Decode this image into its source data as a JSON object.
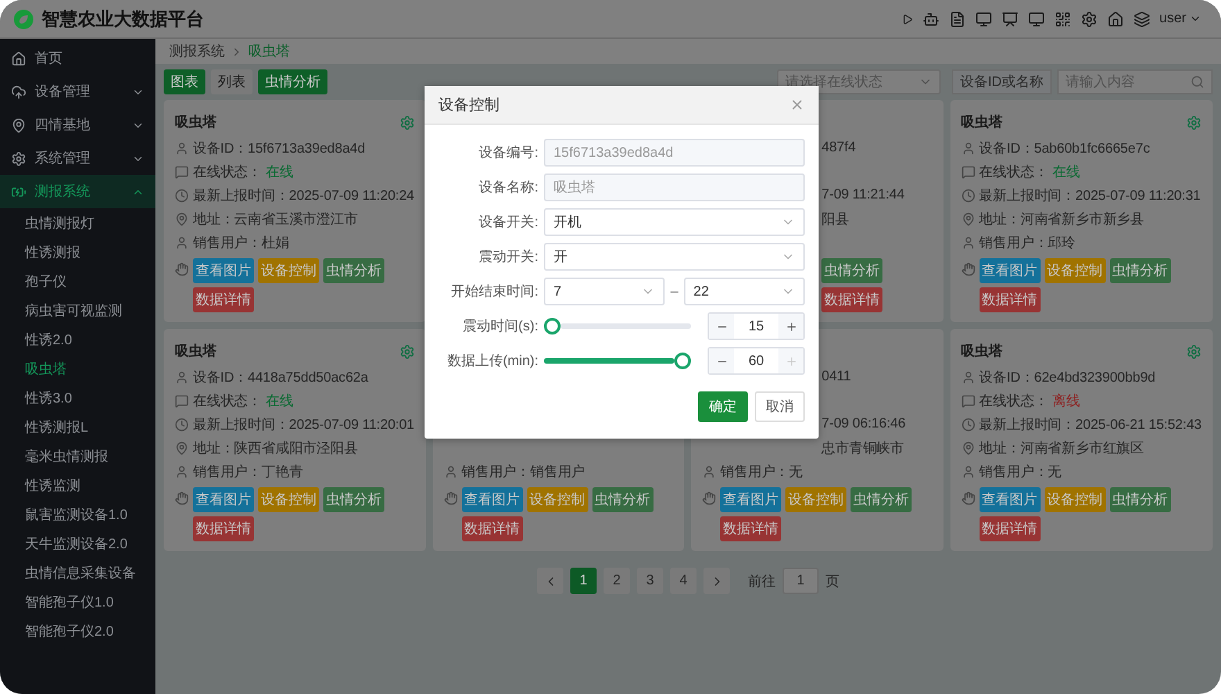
{
  "header": {
    "title": "智慧农业大数据平台",
    "user": "user"
  },
  "sidebar": {
    "items": [
      {
        "label": "首页",
        "selected": false
      },
      {
        "label": "设备管理",
        "selected": false,
        "expanded": false
      },
      {
        "label": "四情基地",
        "selected": false,
        "expanded": false
      },
      {
        "label": "系统管理",
        "selected": false,
        "expanded": false
      },
      {
        "label": "测报系统",
        "selected": true,
        "expanded": true,
        "children": [
          {
            "label": "虫情测报灯",
            "selected": false
          },
          {
            "label": "性诱测报",
            "selected": false
          },
          {
            "label": "孢子仪",
            "selected": false
          },
          {
            "label": "病虫害可视监测",
            "selected": false
          },
          {
            "label": "性诱2.0",
            "selected": false
          },
          {
            "label": "吸虫塔",
            "selected": true
          },
          {
            "label": "性诱3.0",
            "selected": false
          },
          {
            "label": "性诱测报L",
            "selected": false
          },
          {
            "label": "毫米虫情测报",
            "selected": false
          },
          {
            "label": "性诱监测",
            "selected": false
          },
          {
            "label": "鼠害监测设备1.0",
            "selected": false
          },
          {
            "label": "天牛监测设备2.0",
            "selected": false
          },
          {
            "label": "虫情信息采集设备",
            "selected": false
          },
          {
            "label": "智能孢子仪1.0",
            "selected": false
          },
          {
            "label": "智能孢子仪2.0",
            "selected": false
          }
        ]
      }
    ]
  },
  "breadcrumb": [
    {
      "label": "测报系统",
      "selected": false
    },
    {
      "label": "吸虫塔",
      "selected": true
    }
  ],
  "toolbar": {
    "buttons": [
      {
        "label": "图表",
        "color": "#0e5f28"
      },
      {
        "label": "列表",
        "color": "#7a7a7a"
      },
      {
        "label": "虫情分析",
        "color": "#0e5f28"
      }
    ],
    "status_select": {
      "placeholder": "请选择在线状态"
    },
    "search_label": "设备ID或名称",
    "search": {
      "placeholder": "请输入内容"
    }
  },
  "cards": [
    {
      "title": "吸虫塔",
      "rows": [
        {
          "kind": "id",
          "text": "设备ID：15f6713a39ed8a4d"
        },
        {
          "kind": "status",
          "label": "在线状态：",
          "value": "在线",
          "online": true
        },
        {
          "kind": "time",
          "text": "最新上报时间：2025-07-09 11:20:24"
        },
        {
          "kind": "address",
          "text": "地址：云南省玉溪市澄江市"
        },
        {
          "kind": "user",
          "text": "销售用户：杜娟"
        }
      ],
      "buttons": [
        {
          "label": "查看图片",
          "color": "#14719a"
        },
        {
          "label": "设备控制",
          "color": "#a07300"
        },
        {
          "label": "虫情分析",
          "color": "#376c43"
        },
        {
          "label": "数据详情",
          "color": "#983434"
        }
      ]
    },
    {
      "rows": [
        {
          "kind": "id",
          "text": "487f4",
          "clipped": true
        },
        {
          "kind": "time",
          "text": "7-09 11:21:44",
          "clipped": true
        },
        {
          "kind": "address",
          "text": "阳县",
          "clipped": true
        }
      ],
      "buttons_clipped": true,
      "buttons": [
        {
          "label": "虫情分析",
          "color": "#376c43"
        },
        {
          "label": "数据详情",
          "color": "#983434"
        }
      ]
    },
    {
      "title": "吸虫塔",
      "rows": [
        {
          "kind": "id",
          "text": "设备ID：5ab60b1fc6665e7c"
        },
        {
          "kind": "status",
          "label": "在线状态：",
          "value": "在线",
          "online": true
        },
        {
          "kind": "time",
          "text": "最新上报时间：2025-07-09 11:20:31"
        },
        {
          "kind": "address",
          "text": "地址：河南省新乡市新乡县"
        },
        {
          "kind": "user",
          "text": "销售用户：邱玲"
        }
      ],
      "buttons": [
        {
          "label": "查看图片",
          "color": "#14719a"
        },
        {
          "label": "设备控制",
          "color": "#a07300"
        },
        {
          "label": "虫情分析",
          "color": "#376c43"
        },
        {
          "label": "数据详情",
          "color": "#983434"
        }
      ]
    },
    {
      "title": "吸虫塔",
      "rows": [
        {
          "kind": "id",
          "text": "设备ID：4418a75dd50ac62a"
        },
        {
          "kind": "status",
          "label": "在线状态：",
          "value": "在线",
          "online": true
        },
        {
          "kind": "time",
          "text": "最新上报时间：2025-07-09 11:20:01"
        },
        {
          "kind": "address",
          "text": "地址：陕西省咸阳市泾阳县"
        },
        {
          "kind": "user",
          "text": "销售用户：丁艳青"
        }
      ],
      "buttons": [
        {
          "label": "查看图片",
          "color": "#14719a"
        },
        {
          "label": "设备控制",
          "color": "#a07300"
        },
        {
          "label": "虫情分析",
          "color": "#376c43"
        },
        {
          "label": "数据详情",
          "color": "#983434"
        }
      ]
    },
    {
      "rows": [
        {
          "kind": "user",
          "text": "销售用户：销售用户"
        }
      ],
      "buttons": [
        {
          "label": "查看图片",
          "color": "#14719a"
        },
        {
          "label": "设备控制",
          "color": "#a07300"
        },
        {
          "label": "虫情分析",
          "color": "#376c43"
        },
        {
          "label": "数据详情",
          "color": "#983434"
        }
      ]
    },
    {
      "rows": [
        {
          "kind": "id",
          "text": "0411",
          "clipped": true
        },
        {
          "kind": "time",
          "text": "7-09 06:16:46",
          "clipped": true
        },
        {
          "kind": "address",
          "text": "忠市青铜峡市",
          "clipped": true
        },
        {
          "kind": "user",
          "text": "销售用户：无"
        }
      ],
      "buttons": [
        {
          "label": "查看图片",
          "color": "#14719a"
        },
        {
          "label": "设备控制",
          "color": "#a07300"
        },
        {
          "label": "虫情分析",
          "color": "#376c43"
        },
        {
          "label": "数据详情",
          "color": "#983434"
        }
      ]
    },
    {
      "title": "吸虫塔",
      "rows": [
        {
          "kind": "id",
          "text": "设备ID：62e4bd323900bb9d"
        },
        {
          "kind": "status",
          "label": "在线状态：",
          "value": "离线",
          "online": false
        },
        {
          "kind": "time",
          "text": "最新上报时间：2025-06-21 15:52:43"
        },
        {
          "kind": "address",
          "text": "地址：河南省新乡市红旗区"
        },
        {
          "kind": "user",
          "text": "销售用户：无"
        }
      ],
      "buttons": [
        {
          "label": "查看图片",
          "color": "#14719a"
        },
        {
          "label": "设备控制",
          "color": "#a07300"
        },
        {
          "label": "虫情分析",
          "color": "#376c43"
        },
        {
          "label": "数据详情",
          "color": "#983434"
        }
      ]
    }
  ],
  "pagination": {
    "pages": [
      {
        "label": "1",
        "selected": true
      },
      {
        "label": "2",
        "selected": false
      },
      {
        "label": "3",
        "selected": false
      },
      {
        "label": "4",
        "selected": false
      }
    ],
    "goto_label": "前往",
    "goto_value": "1",
    "page_suffix": "页"
  },
  "dialog": {
    "title": "设备控制",
    "fields": [
      {
        "kind": "input",
        "label": "设备编号:",
        "value": "15f6713a39ed8a4d",
        "disabled": true
      },
      {
        "kind": "input",
        "label": "设备名称:",
        "value": "吸虫塔",
        "disabled": true
      },
      {
        "kind": "select",
        "label": "设备开关:",
        "value": "开机"
      },
      {
        "kind": "select",
        "label": "震动开关:",
        "value": "开"
      },
      {
        "kind": "range",
        "label": "开始结束时间:",
        "from": "7",
        "separator": "–",
        "to": "22"
      },
      {
        "kind": "slider",
        "label": "震动时间(s):",
        "level": 0,
        "value": "15",
        "plus_disabled": false
      },
      {
        "kind": "slider",
        "label": "数据上传(min):",
        "level": 1,
        "value": "60",
        "plus_disabled": true
      }
    ],
    "buttons": [
      {
        "label": "确定",
        "primary": true
      },
      {
        "label": "取消",
        "primary": false
      }
    ]
  }
}
